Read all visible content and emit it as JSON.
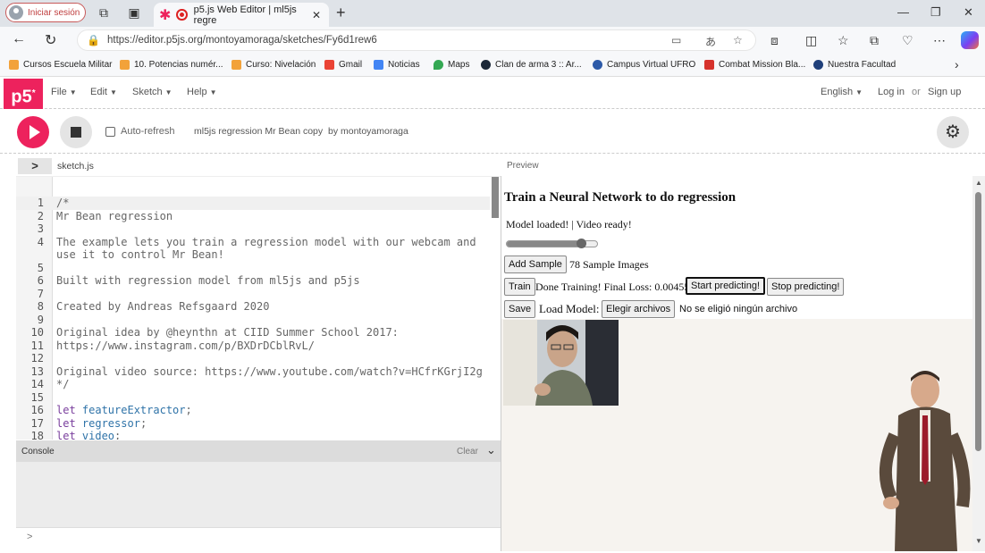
{
  "browser": {
    "profile_label": "Iniciar sesión",
    "tab_title": "p5.js Web Editor | ml5js regre",
    "new_tab": "+",
    "url": "https://editor.p5js.org/montoyamoraga/sketches/Fy6d1rew6"
  },
  "bookmarks": [
    "Cursos Escuela Militar",
    "10. Potencias numér...",
    "Curso: Nivelación",
    "Gmail",
    "Noticias",
    "Maps",
    "Clan de arma 3 :: Ar...",
    "Campus Virtual UFRO",
    "Combat Mission Bla...",
    "Nuestra Facultad"
  ],
  "p5": {
    "logo": "p5",
    "menu": [
      "File",
      "Edit",
      "Sketch",
      "Help"
    ],
    "language": "English",
    "login": "Log in",
    "or": "or",
    "signup": "Sign up",
    "auto_refresh": "Auto-refresh",
    "sketch_name": "ml5js regression Mr Bean copy",
    "by_author": "by montoyamoraga",
    "file_tab": "sketch.js",
    "preview_label": "Preview",
    "console_label": "Console",
    "clear_label": "Clear",
    "console_prompt": ">"
  },
  "code": [
    {
      "n": "1",
      "t": "/*"
    },
    {
      "n": "2",
      "t": "Mr Bean regression"
    },
    {
      "n": "3",
      "t": ""
    },
    {
      "n": "4",
      "t": "The example lets you train a regression model with our webcam and"
    },
    {
      "n": "",
      "t": "use it to control Mr Bean!"
    },
    {
      "n": "5",
      "t": ""
    },
    {
      "n": "6",
      "t": "Built with regression model from ml5js and p5js"
    },
    {
      "n": "7",
      "t": ""
    },
    {
      "n": "8",
      "t": "Created by Andreas Refsgaard 2020"
    },
    {
      "n": "9",
      "t": ""
    },
    {
      "n": "10",
      "t": "Original idea by @heynthn at CIID Summer School 2017:"
    },
    {
      "n": "11",
      "t": "https://www.instagram.com/p/BXDrDCblRvL/"
    },
    {
      "n": "12",
      "t": ""
    },
    {
      "n": "13",
      "t": "Original video source: https://www.youtube.com/watch?v=HCfrKGrjI2g"
    },
    {
      "n": "14",
      "t": "*/"
    },
    {
      "n": "15",
      "t": ""
    },
    {
      "n": "16",
      "kw": "let ",
      "id": "featureExtractor",
      "rest": ";"
    },
    {
      "n": "17",
      "kw": "let ",
      "id": "regressor",
      "rest": ";"
    },
    {
      "n": "18",
      "kw": "let ",
      "id": "video",
      "rest": ";"
    }
  ],
  "preview": {
    "title": "Train a Neural Network to do regression",
    "status": "Model loaded! | Video ready!",
    "slider_value": 0.82,
    "add_sample": "Add Sample",
    "sample_count": "78 Sample Images",
    "train": "Train",
    "train_status": "Done Training! Final Loss: 0.00455",
    "start_predicting": "Start predicting!",
    "stop_predicting": "Stop predicting!",
    "save": "Save",
    "load_model": "Load Model:",
    "choose_files": "Elegir archivos",
    "no_file": "No se eligió ningún archivo"
  },
  "colors": {
    "p5_pink": "#ed225d"
  }
}
